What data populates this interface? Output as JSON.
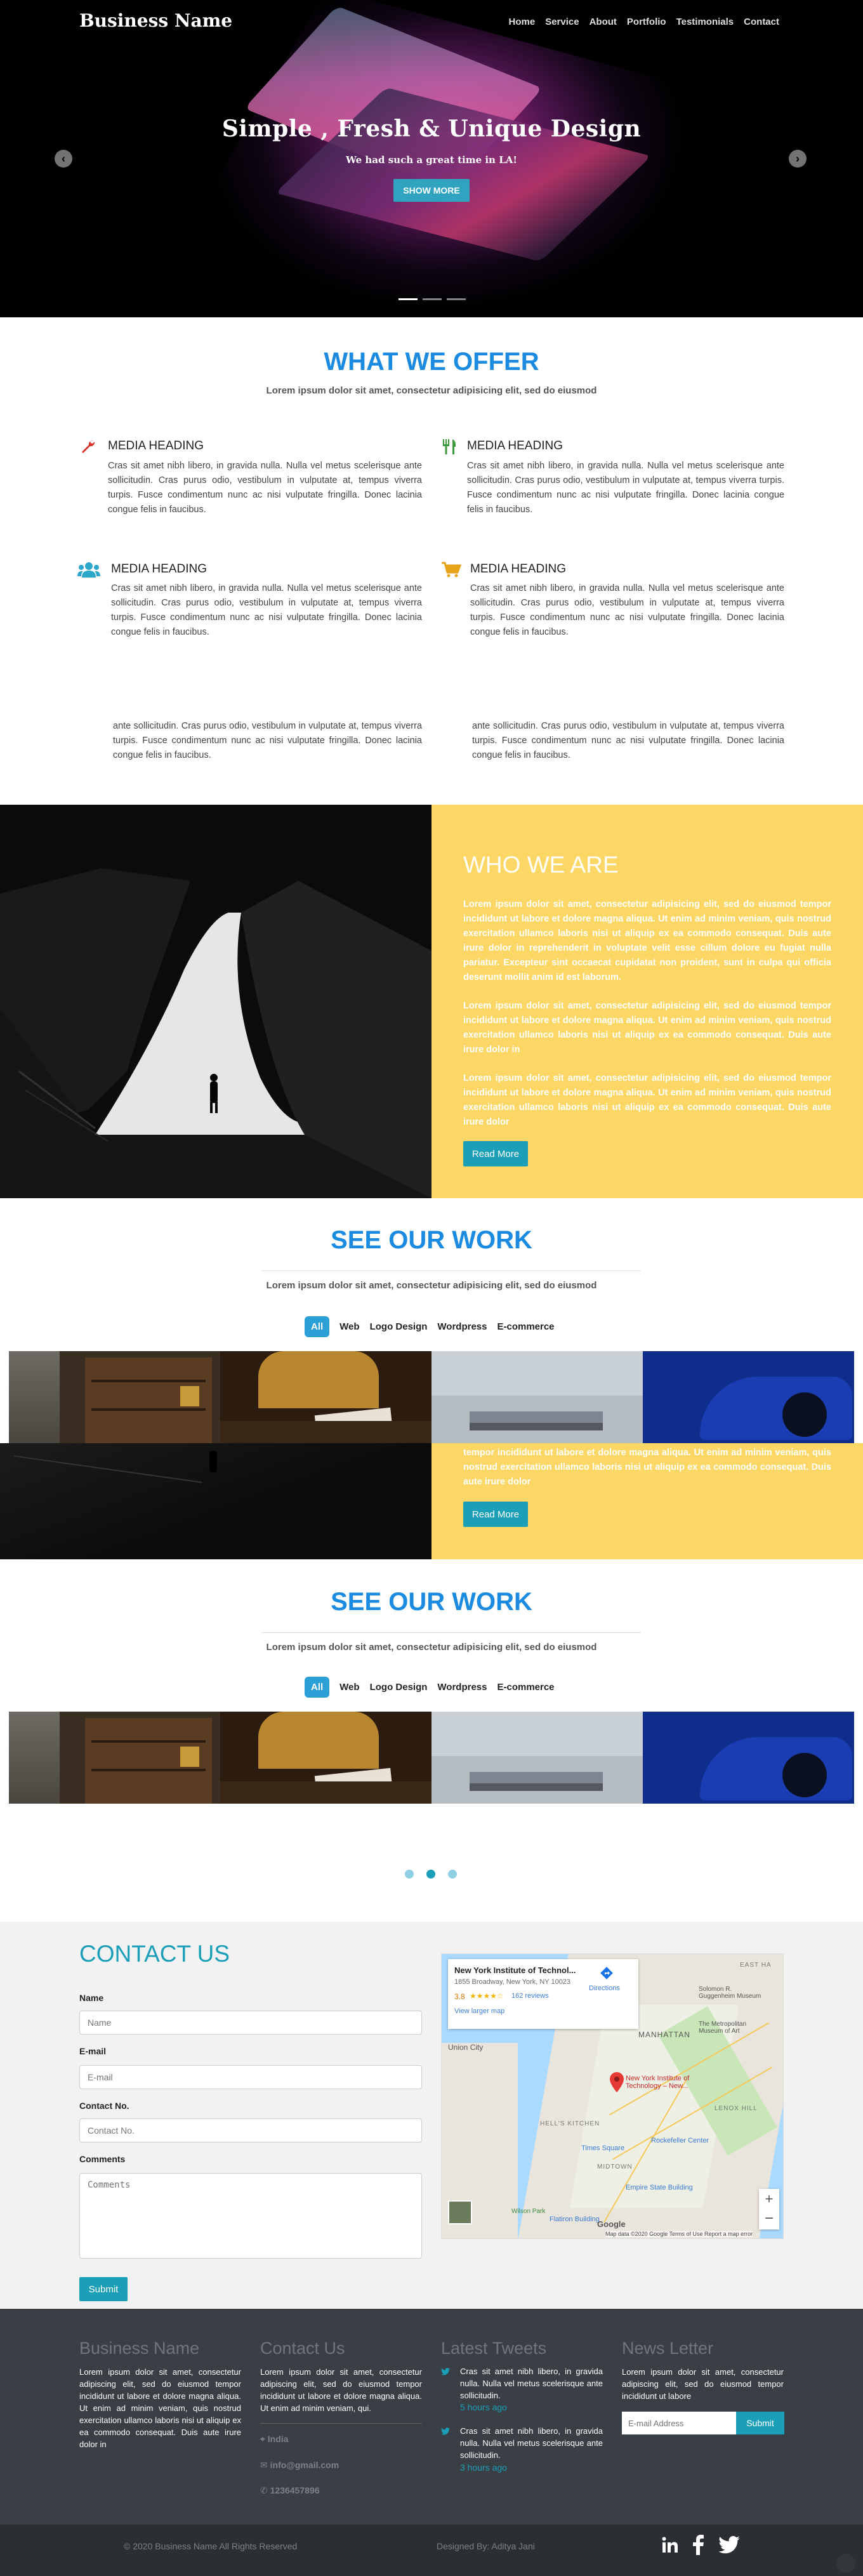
{
  "header": {
    "brand": "Business Name",
    "nav": [
      "Home",
      "Service",
      "About",
      "Portfolio",
      "Testimonials",
      "Contact"
    ]
  },
  "hero": {
    "title": "Simple , Fresh & Unique Design",
    "subtitle": "We had such a great time in LA!",
    "button": "SHOW MORE",
    "prev_icon": "chevron-left-icon",
    "next_icon": "chevron-right-icon"
  },
  "offer": {
    "title": "WHAT WE OFFER",
    "subtitle": "Lorem ipsum dolor sit amet, consectetur adipisicing elit, sed do eiusmod",
    "items": [
      {
        "icon": "wrench-icon",
        "heading": "MEDIA HEADING",
        "text": "Cras sit amet nibh libero, in gravida nulla. Nulla vel metus scelerisque ante sollicitudin. Cras purus odio, vestibulum in vulputate at, tempus viverra turpis. Fusce condimentum nunc ac nisi vulputate fringilla. Donec lacinia congue felis in faucibus."
      },
      {
        "icon": "cutlery-icon",
        "heading": "MEDIA HEADING",
        "text": "Cras sit amet nibh libero, in gravida nulla. Nulla vel metus scelerisque ante sollicitudin. Cras purus odio, vestibulum in vulputate at, tempus viverra turpis. Fusce condimentum nunc ac nisi vulputate fringilla. Donec lacinia congue felis in faucibus."
      },
      {
        "icon": "users-icon",
        "heading": "MEDIA HEADING",
        "text": "Cras sit amet nibh libero, in gravida nulla. Nulla vel metus scelerisque ante sollicitudin. Cras purus odio, vestibulum in vulputate at, tempus viverra turpis. Fusce condimentum nunc ac nisi vulputate fringilla. Donec lacinia congue felis in faucibus."
      },
      {
        "icon": "cart-icon",
        "heading": "MEDIA HEADING",
        "text": "Cras sit amet nibh libero, in gravida nulla. Nulla vel metus scelerisque ante sollicitudin. Cras purus odio, vestibulum in vulputate at, tempus viverra turpis. Fusce condimentum nunc ac nisi vulputate fringilla. Donec lacinia congue felis in faucibus."
      }
    ],
    "overflow_text": "ante sollicitudin. Cras purus odio, vestibulum in vulputate at, tempus viverra turpis. Fusce condimentum nunc ac nisi vulputate fringilla. Donec lacinia congue felis in faucibus."
  },
  "who": {
    "title": "WHO WE ARE",
    "p1": "Lorem ipsum dolor sit amet, consectetur adipisicing elit, sed do eiusmod tempor incididunt ut labore et dolore magna aliqua. Ut enim ad minim veniam, quis nostrud exercitation ullamco laboris nisi ut aliquip ex ea commodo consequat. Duis aute irure dolor in reprehenderit in voluptate velit esse cillum dolore eu fugiat nulla pariatur. Excepteur sint occaecat cupidatat non proident, sunt in culpa qui officia deserunt mollit anim id est laborum.",
    "p2": "Lorem ipsum dolor sit amet, consectetur adipisicing elit, sed do eiusmod tempor incididunt ut labore et dolore magna aliqua. Ut enim ad minim veniam, quis nostrud exercitation ullamco laboris nisi ut aliquip ex ea commodo consequat. Duis aute irure dolor in",
    "p3": "Lorem ipsum dolor sit amet, consectetur adipisicing elit, sed do eiusmod tempor incididunt ut labore et dolore magna aliqua. Ut enim ad minim veniam, quis nostrud exercitation ullamco laboris nisi ut aliquip ex ea commodo consequat. Duis aute irure dolor",
    "overlap_text": "tempor incididunt ut labore et dolore magna aliqua. Ut enim ad minim veniam, quis nostrud exercitation ullamco laboris nisi ut aliquip ex ea commodo consequat. Duis aute irure dolor",
    "button": "Read More"
  },
  "work": {
    "title": "SEE OUR WORK",
    "subtitle": "Lorem ipsum dolor sit amet, consectetur adipisicing elit, sed do eiusmod",
    "filters": [
      "All",
      "Web",
      "Logo Design",
      "Wordpress",
      "E-commerce"
    ]
  },
  "contact": {
    "title": "CONTACT US",
    "fields": [
      {
        "label": "Name",
        "placeholder": "Name"
      },
      {
        "label": "E-mail",
        "placeholder": "E-mail"
      },
      {
        "label": "Contact No.",
        "placeholder": "Contact No."
      },
      {
        "label": "Comments",
        "placeholder": "Comments"
      }
    ],
    "submit": "Submit",
    "map": {
      "place": "New York Institute of Technol...",
      "address": "1855 Broadway, New York, NY 10023",
      "rating": "3.8",
      "stars": "★★★★☆",
      "reviews": "162 reviews",
      "larger": "View larger map",
      "directions": "Directions",
      "pin_label": "New York Institute of Technology – New...",
      "labels": [
        "MANHATTAN",
        "Times Square",
        "Rockefeller Center",
        "Empire State Building",
        "Flatiron Building",
        "MIDTOWN",
        "HELL'S KITCHEN",
        "Union City",
        "LENOX HILL",
        "EAST HA",
        "Solomon R. Guggenheim Museum",
        "The Metropolitan Museum of Art",
        "Wilson Park"
      ],
      "footer": "Map data ©2020 Google  Terms of Use  Report a map error",
      "google": "Google"
    }
  },
  "footer": {
    "col1_title": "Business Name",
    "col1_text": "Lorem ipsum dolor sit amet, consectetur adipiscing elit, sed do eiusmod tempor incididunt ut labore et dolore magna aliqua. Ut enim ad minim veniam, quis nostrud exercitation ullamco laboris nisi ut aliquip ex ea commodo consequat. Duis aute irure dolor in",
    "col2_title": "Contact Us",
    "col2_text": "Lorem ipsum dolor sit amet, consectetur adipiscing elit, sed do eiusmod tempor incididunt ut labore et dolore magna aliqua. Ut enim ad minim veniam, qui.",
    "location": "India",
    "email": "info@gmail.com",
    "phone": "1236457896",
    "col3_title": "Latest Tweets",
    "tweet1": "Cras sit amet nibh libero, in gravida nulla. Nulla vel metus scelerisque ante sollicitudin.",
    "tweet1_time": "5 hours ago",
    "tweet2": "Cras sit amet nibh libero, in gravida nulla. Nulla vel metus scelerisque ante sollicitudin.",
    "tweet2_time": "3 hours ago",
    "col4_title": "News Letter",
    "col4_text": "Lorem ipsum dolor sit amet, consectetur adipiscing elit, sed do eiusmod tempor incididunt ut labore",
    "email_placeholder": "E-mail Address",
    "submit": "Submit"
  },
  "bottom": {
    "copyright": "© 2020 Business Name All Rights Reserved",
    "designed": "Designed By: Aditya Jani",
    "social": [
      "linkedin-icon",
      "facebook-icon",
      "twitter-icon"
    ]
  },
  "colors": {
    "accent_blue": "#1a8be0",
    "teal_button": "#1b9eb8",
    "yellow": "#fdd766",
    "footer_dark": "#3a3f45"
  }
}
